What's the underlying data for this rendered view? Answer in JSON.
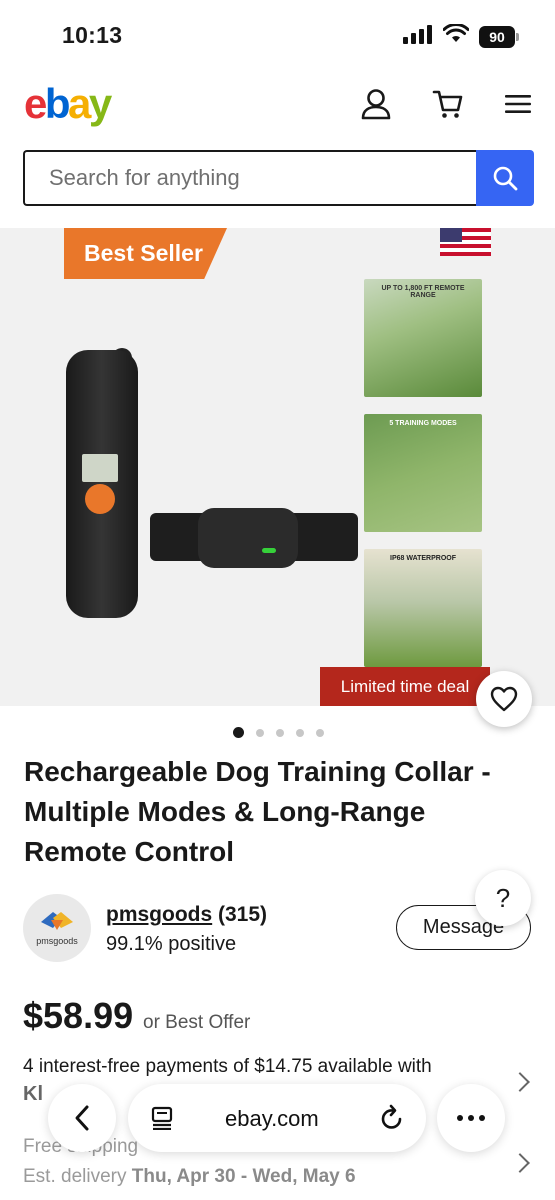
{
  "status_bar": {
    "time": "10:13",
    "battery": "90"
  },
  "header": {
    "logo_letters": [
      "e",
      "b",
      "a",
      "y"
    ]
  },
  "search": {
    "placeholder": "Search for anything"
  },
  "gallery": {
    "badge": "Best Seller",
    "thumbnails": [
      "UP TO 1,800 FT REMOTE RANGE",
      "5 TRAINING MODES",
      "IP68 WATERPROOF"
    ],
    "deal_banner": "Limited time deal",
    "dots_total": 5,
    "dots_active": 1
  },
  "product": {
    "title": "Rechargeable Dog Training Collar - Multiple Modes & Long-Range Remote Control",
    "price": "$58.99",
    "offer": "or Best Offer"
  },
  "seller": {
    "avatar_label": "pmsgoods",
    "name": "pmsgoods",
    "count": " (315)",
    "feedback": "99.1% positive",
    "message_label": "Message"
  },
  "help": {
    "label": "?"
  },
  "payments": {
    "text": "4 interest-free payments of $14.75 available with",
    "provider": "Kl"
  },
  "shipping": {
    "line1": "Free shipping",
    "line2_prefix": "Est. delivery ",
    "line2_dates": "Thu, Apr 30 - Wed, May 6"
  },
  "browser": {
    "url": "ebay.com"
  },
  "colors": {
    "accent": "#3665f3",
    "badge_orange": "#e9772a",
    "deal_red": "#b4271c"
  }
}
